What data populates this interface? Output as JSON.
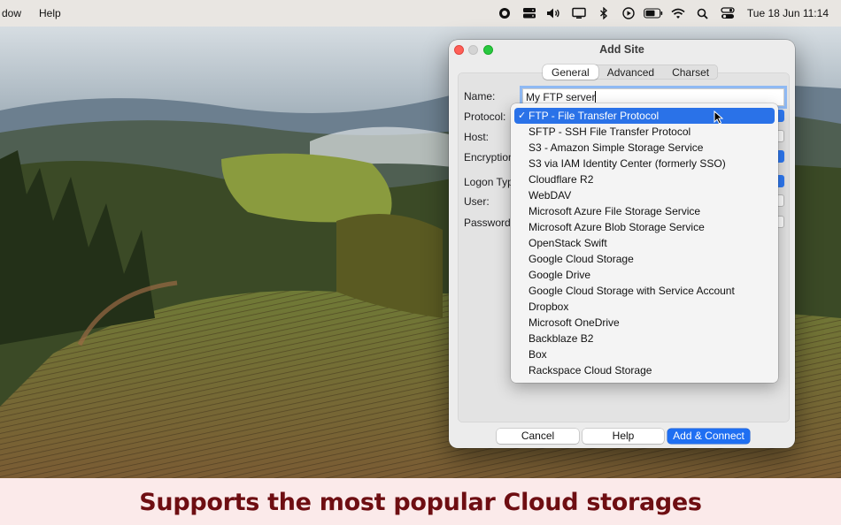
{
  "menubar": {
    "items": [
      "dow",
      "Help"
    ],
    "clock": "Tue 18 Jun  11:14",
    "status_icons": [
      "record-icon",
      "server-stack-icon",
      "volume-icon",
      "display-icon",
      "bluetooth-icon",
      "play-icon",
      "battery-icon",
      "wifi-icon",
      "search-icon",
      "control-center-icon"
    ]
  },
  "window": {
    "title": "Add Site",
    "tabs": [
      "General",
      "Advanced",
      "Charset"
    ],
    "active_tab": "General",
    "labels": {
      "name": "Name:",
      "protocol": "Protocol:",
      "host": "Host:",
      "encryption": "Encryption",
      "logon_type": "Logon Typ",
      "user": "User:",
      "password": "Password:"
    },
    "name_value": "My FTP server",
    "buttons": {
      "cancel": "Cancel",
      "help": "Help",
      "add_connect": "Add & Connect"
    }
  },
  "protocol_dropdown": {
    "selected_check": "✓",
    "items": [
      "FTP - File Transfer Protocol",
      "SFTP - SSH File Transfer Protocol",
      "S3 - Amazon Simple Storage Service",
      "S3 via IAM Identity Center (formerly SSO)",
      "Cloudflare R2",
      "WebDAV",
      "Microsoft Azure File Storage Service",
      "Microsoft Azure Blob Storage Service",
      "OpenStack Swift",
      "Google Cloud Storage",
      "Google Drive",
      "Google Cloud Storage with Service Account",
      "Dropbox",
      "Microsoft OneDrive",
      "Backblaze B2",
      "Box",
      "Rackspace Cloud Storage"
    ],
    "selected_index": 0
  },
  "caption": "Supports the most popular Cloud storages",
  "colors": {
    "accent": "#2a72e8",
    "caption_text": "#6e0e12",
    "caption_bg": "#fbeaea"
  }
}
